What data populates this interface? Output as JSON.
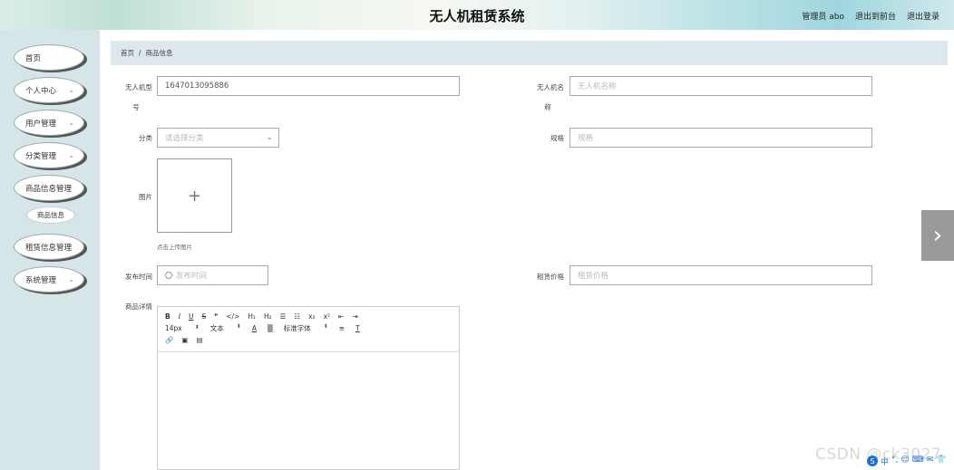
{
  "header": {
    "title": "无人机租赁系统",
    "admin": "管理员 abo",
    "back_front": "退出到前台",
    "logout": "退出登录"
  },
  "sidebar": {
    "items": [
      {
        "label": "首页",
        "has_chevron": false
      },
      {
        "label": "个人中心",
        "has_chevron": true
      },
      {
        "label": "用户管理",
        "has_chevron": true
      },
      {
        "label": "分类管理",
        "has_chevron": true
      },
      {
        "label": "商品信息管理",
        "has_chevron": true
      },
      {
        "label": "租赁信息管理",
        "has_chevron": true
      },
      {
        "label": "系统管理",
        "has_chevron": true
      }
    ],
    "submenu": "商品信息",
    "chevron": "⌄"
  },
  "breadcrumb": {
    "home": "首页",
    "sep": "/",
    "current": "商品信息"
  },
  "form": {
    "model_label_1": "无人机型",
    "model_label_2": "号",
    "model_value": "1647013095886",
    "name_label_1": "无人机名",
    "name_label_2": "称",
    "name_placeholder": "无人机名称",
    "category_label": "分类",
    "category_placeholder": "请选择分类",
    "spec_label": "规格",
    "spec_placeholder": "规格",
    "image_label": "图片",
    "upload_plus": "+",
    "upload_tip": "点击上传图片",
    "publish_label": "发布时间",
    "publish_placeholder": "发布时间",
    "price_label": "租赁价格",
    "price_placeholder": "租赁价格",
    "detail_label": "商品详情"
  },
  "editor": {
    "row1": [
      "B",
      "I",
      "U",
      "S",
      "❞",
      "</>",
      "H₁",
      "H₂",
      "☰",
      "☷",
      "x₂",
      "x²",
      "⇤",
      "⇥"
    ],
    "font_size": "14px",
    "text_style": "文本",
    "font_family": "标准字体",
    "row3": [
      "🔗",
      "▣",
      "▤"
    ]
  },
  "overlay": {
    "next_arrow": "›",
    "watermark": "CSDN @ck3027",
    "ime": [
      "中",
      "°,",
      "☺",
      "⌨",
      "✉",
      "👕"
    ]
  }
}
